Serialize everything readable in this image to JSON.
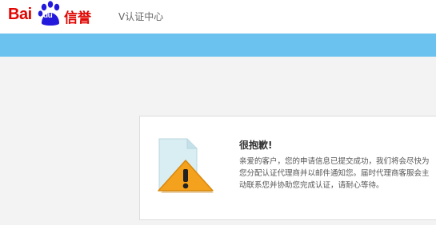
{
  "header": {
    "logo_bai": "Bai",
    "logo_du": "du",
    "logo_xinyu": "信誉",
    "subtitle": "V认证中心"
  },
  "colors": {
    "brand_red": "#e10602",
    "paw_blue": "#2319dc",
    "banner_blue": "#6cc2ee",
    "warning_orange": "#f4a11d"
  },
  "notice": {
    "icon": "warning-icon",
    "title": "很抱歉!",
    "message": "亲爱的客户，您的申请信息已提交成功，我们将会尽快为您分配认证代理商并以邮件通知您。届时代理商客服会主动联系您并协助您完成认证，请耐心等待。"
  }
}
